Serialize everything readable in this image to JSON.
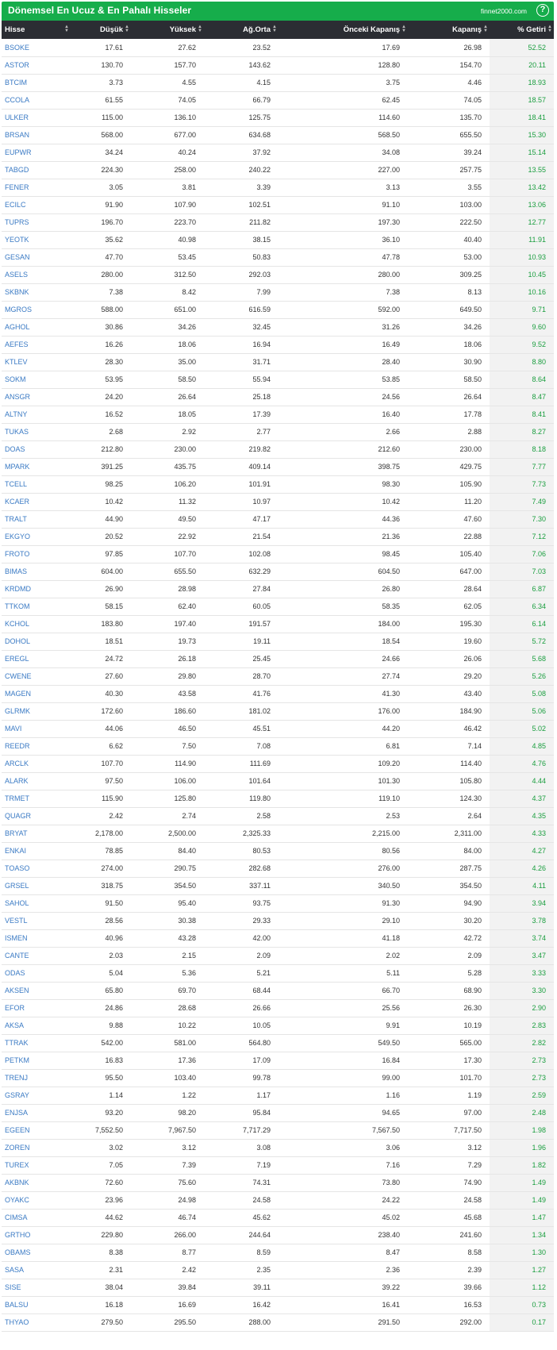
{
  "header": {
    "title": "Dönemsel En Ucuz & En Pahalı Hisseler",
    "brand": "finnet2000.com",
    "help": "?"
  },
  "columns": [
    "Hisse",
    "Düşük",
    "Yüksek",
    "Ağ.Orta",
    "Önceki Kapanış",
    "Kapanış",
    "% Getiri"
  ],
  "rows": [
    [
      "BSOKE",
      "17.61",
      "27.62",
      "23.52",
      "17.69",
      "26.98",
      "52.52"
    ],
    [
      "ASTOR",
      "130.70",
      "157.70",
      "143.62",
      "128.80",
      "154.70",
      "20.11"
    ],
    [
      "BTCIM",
      "3.73",
      "4.55",
      "4.15",
      "3.75",
      "4.46",
      "18.93"
    ],
    [
      "CCOLA",
      "61.55",
      "74.05",
      "66.79",
      "62.45",
      "74.05",
      "18.57"
    ],
    [
      "ULKER",
      "115.00",
      "136.10",
      "125.75",
      "114.60",
      "135.70",
      "18.41"
    ],
    [
      "BRSAN",
      "568.00",
      "677.00",
      "634.68",
      "568.50",
      "655.50",
      "15.30"
    ],
    [
      "EUPWR",
      "34.24",
      "40.24",
      "37.92",
      "34.08",
      "39.24",
      "15.14"
    ],
    [
      "TABGD",
      "224.30",
      "258.00",
      "240.22",
      "227.00",
      "257.75",
      "13.55"
    ],
    [
      "FENER",
      "3.05",
      "3.81",
      "3.39",
      "3.13",
      "3.55",
      "13.42"
    ],
    [
      "ECILC",
      "91.90",
      "107.90",
      "102.51",
      "91.10",
      "103.00",
      "13.06"
    ],
    [
      "TUPRS",
      "196.70",
      "223.70",
      "211.82",
      "197.30",
      "222.50",
      "12.77"
    ],
    [
      "YEOTK",
      "35.62",
      "40.98",
      "38.15",
      "36.10",
      "40.40",
      "11.91"
    ],
    [
      "GESAN",
      "47.70",
      "53.45",
      "50.83",
      "47.78",
      "53.00",
      "10.93"
    ],
    [
      "ASELS",
      "280.00",
      "312.50",
      "292.03",
      "280.00",
      "309.25",
      "10.45"
    ],
    [
      "SKBNK",
      "7.38",
      "8.42",
      "7.99",
      "7.38",
      "8.13",
      "10.16"
    ],
    [
      "MGROS",
      "588.00",
      "651.00",
      "616.59",
      "592.00",
      "649.50",
      "9.71"
    ],
    [
      "AGHOL",
      "30.86",
      "34.26",
      "32.45",
      "31.26",
      "34.26",
      "9.60"
    ],
    [
      "AEFES",
      "16.26",
      "18.06",
      "16.94",
      "16.49",
      "18.06",
      "9.52"
    ],
    [
      "KTLEV",
      "28.30",
      "35.00",
      "31.71",
      "28.40",
      "30.90",
      "8.80"
    ],
    [
      "SOKM",
      "53.95",
      "58.50",
      "55.94",
      "53.85",
      "58.50",
      "8.64"
    ],
    [
      "ANSGR",
      "24.20",
      "26.64",
      "25.18",
      "24.56",
      "26.64",
      "8.47"
    ],
    [
      "ALTNY",
      "16.52",
      "18.05",
      "17.39",
      "16.40",
      "17.78",
      "8.41"
    ],
    [
      "TUKAS",
      "2.68",
      "2.92",
      "2.77",
      "2.66",
      "2.88",
      "8.27"
    ],
    [
      "DOAS",
      "212.80",
      "230.00",
      "219.82",
      "212.60",
      "230.00",
      "8.18"
    ],
    [
      "MPARK",
      "391.25",
      "435.75",
      "409.14",
      "398.75",
      "429.75",
      "7.77"
    ],
    [
      "TCELL",
      "98.25",
      "106.20",
      "101.91",
      "98.30",
      "105.90",
      "7.73"
    ],
    [
      "KCAER",
      "10.42",
      "11.32",
      "10.97",
      "10.42",
      "11.20",
      "7.49"
    ],
    [
      "TRALT",
      "44.90",
      "49.50",
      "47.17",
      "44.36",
      "47.60",
      "7.30"
    ],
    [
      "EKGYO",
      "20.52",
      "22.92",
      "21.54",
      "21.36",
      "22.88",
      "7.12"
    ],
    [
      "FROTO",
      "97.85",
      "107.70",
      "102.08",
      "98.45",
      "105.40",
      "7.06"
    ],
    [
      "BIMAS",
      "604.00",
      "655.50",
      "632.29",
      "604.50",
      "647.00",
      "7.03"
    ],
    [
      "KRDMD",
      "26.90",
      "28.98",
      "27.84",
      "26.80",
      "28.64",
      "6.87"
    ],
    [
      "TTKOM",
      "58.15",
      "62.40",
      "60.05",
      "58.35",
      "62.05",
      "6.34"
    ],
    [
      "KCHOL",
      "183.80",
      "197.40",
      "191.57",
      "184.00",
      "195.30",
      "6.14"
    ],
    [
      "DOHOL",
      "18.51",
      "19.73",
      "19.11",
      "18.54",
      "19.60",
      "5.72"
    ],
    [
      "EREGL",
      "24.72",
      "26.18",
      "25.45",
      "24.66",
      "26.06",
      "5.68"
    ],
    [
      "CWENE",
      "27.60",
      "29.80",
      "28.70",
      "27.74",
      "29.20",
      "5.26"
    ],
    [
      "MAGEN",
      "40.30",
      "43.58",
      "41.76",
      "41.30",
      "43.40",
      "5.08"
    ],
    [
      "GLRMK",
      "172.60",
      "186.60",
      "181.02",
      "176.00",
      "184.90",
      "5.06"
    ],
    [
      "MAVI",
      "44.06",
      "46.50",
      "45.51",
      "44.20",
      "46.42",
      "5.02"
    ],
    [
      "REEDR",
      "6.62",
      "7.50",
      "7.08",
      "6.81",
      "7.14",
      "4.85"
    ],
    [
      "ARCLK",
      "107.70",
      "114.90",
      "111.69",
      "109.20",
      "114.40",
      "4.76"
    ],
    [
      "ALARK",
      "97.50",
      "106.00",
      "101.64",
      "101.30",
      "105.80",
      "4.44"
    ],
    [
      "TRMET",
      "115.90",
      "125.80",
      "119.80",
      "119.10",
      "124.30",
      "4.37"
    ],
    [
      "QUAGR",
      "2.42",
      "2.74",
      "2.58",
      "2.53",
      "2.64",
      "4.35"
    ],
    [
      "BRYAT",
      "2,178.00",
      "2,500.00",
      "2,325.33",
      "2,215.00",
      "2,311.00",
      "4.33"
    ],
    [
      "ENKAI",
      "78.85",
      "84.40",
      "80.53",
      "80.56",
      "84.00",
      "4.27"
    ],
    [
      "TOASO",
      "274.00",
      "290.75",
      "282.68",
      "276.00",
      "287.75",
      "4.26"
    ],
    [
      "GRSEL",
      "318.75",
      "354.50",
      "337.11",
      "340.50",
      "354.50",
      "4.11"
    ],
    [
      "SAHOL",
      "91.50",
      "95.40",
      "93.75",
      "91.30",
      "94.90",
      "3.94"
    ],
    [
      "VESTL",
      "28.56",
      "30.38",
      "29.33",
      "29.10",
      "30.20",
      "3.78"
    ],
    [
      "ISMEN",
      "40.96",
      "43.28",
      "42.00",
      "41.18",
      "42.72",
      "3.74"
    ],
    [
      "CANTE",
      "2.03",
      "2.15",
      "2.09",
      "2.02",
      "2.09",
      "3.47"
    ],
    [
      "ODAS",
      "5.04",
      "5.36",
      "5.21",
      "5.11",
      "5.28",
      "3.33"
    ],
    [
      "AKSEN",
      "65.80",
      "69.70",
      "68.44",
      "66.70",
      "68.90",
      "3.30"
    ],
    [
      "EFOR",
      "24.86",
      "28.68",
      "26.66",
      "25.56",
      "26.30",
      "2.90"
    ],
    [
      "AKSA",
      "9.88",
      "10.22",
      "10.05",
      "9.91",
      "10.19",
      "2.83"
    ],
    [
      "TTRAK",
      "542.00",
      "581.00",
      "564.80",
      "549.50",
      "565.00",
      "2.82"
    ],
    [
      "PETKM",
      "16.83",
      "17.36",
      "17.09",
      "16.84",
      "17.30",
      "2.73"
    ],
    [
      "TRENJ",
      "95.50",
      "103.40",
      "99.78",
      "99.00",
      "101.70",
      "2.73"
    ],
    [
      "GSRAY",
      "1.14",
      "1.22",
      "1.17",
      "1.16",
      "1.19",
      "2.59"
    ],
    [
      "ENJSA",
      "93.20",
      "98.20",
      "95.84",
      "94.65",
      "97.00",
      "2.48"
    ],
    [
      "EGEEN",
      "7,552.50",
      "7,967.50",
      "7,717.29",
      "7,567.50",
      "7,717.50",
      "1.98"
    ],
    [
      "ZOREN",
      "3.02",
      "3.12",
      "3.08",
      "3.06",
      "3.12",
      "1.96"
    ],
    [
      "TUREX",
      "7.05",
      "7.39",
      "7.19",
      "7.16",
      "7.29",
      "1.82"
    ],
    [
      "AKBNK",
      "72.60",
      "75.60",
      "74.31",
      "73.80",
      "74.90",
      "1.49"
    ],
    [
      "OYAKC",
      "23.96",
      "24.98",
      "24.58",
      "24.22",
      "24.58",
      "1.49"
    ],
    [
      "CIMSA",
      "44.62",
      "46.74",
      "45.62",
      "45.02",
      "45.68",
      "1.47"
    ],
    [
      "GRTHO",
      "229.80",
      "266.00",
      "244.64",
      "238.40",
      "241.60",
      "1.34"
    ],
    [
      "OBAMS",
      "8.38",
      "8.77",
      "8.59",
      "8.47",
      "8.58",
      "1.30"
    ],
    [
      "SASA",
      "2.31",
      "2.42",
      "2.35",
      "2.36",
      "2.39",
      "1.27"
    ],
    [
      "SISE",
      "38.04",
      "39.84",
      "39.11",
      "39.22",
      "39.66",
      "1.12"
    ],
    [
      "BALSU",
      "16.18",
      "16.69",
      "16.42",
      "16.41",
      "16.53",
      "0.73"
    ],
    [
      "THYAO",
      "279.50",
      "295.50",
      "288.00",
      "291.50",
      "292.00",
      "0.17"
    ]
  ],
  "colors": {
    "header_green": "#16ad4b",
    "thead_dark": "#2b2d33",
    "link_blue": "#3a7ac4",
    "gain_green": "#1a9e3f"
  },
  "icons": {
    "help": "question-circle-icon",
    "sort": "sort-arrows-icon"
  }
}
